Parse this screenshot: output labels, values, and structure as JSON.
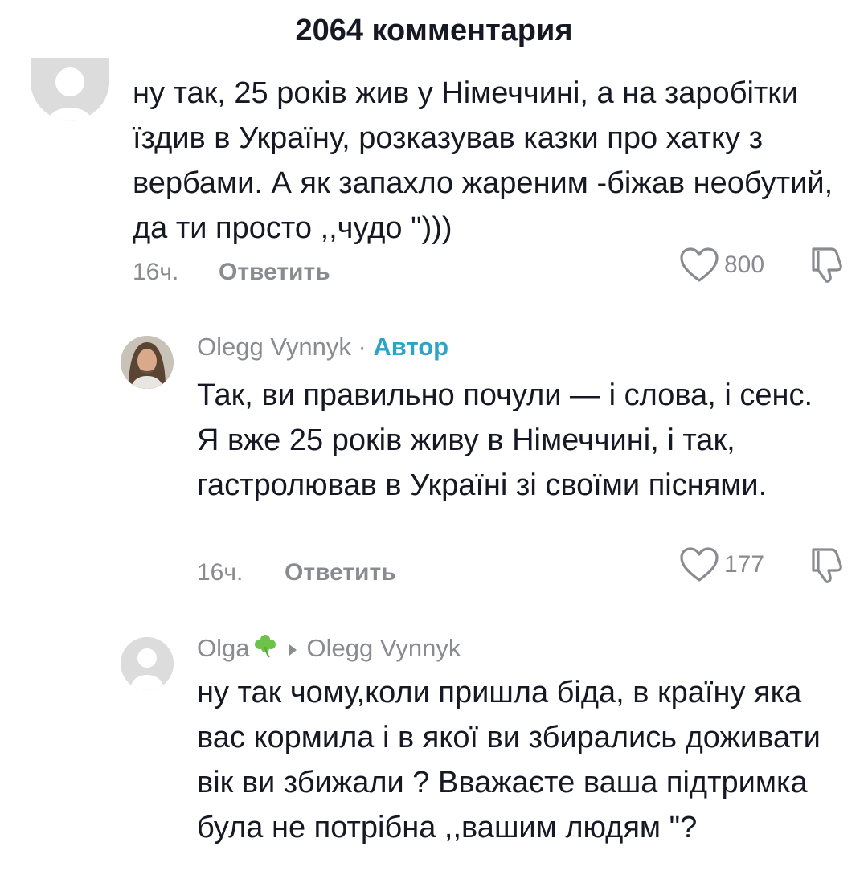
{
  "header": {
    "title": "2064 комментария"
  },
  "comments": [
    {
      "text": "ну так, 25 років жив у Німеччині, а на заробітки їздив в Україну, розказував казки про хатку з вербами. А як запахло жареним -біжав необутий, да ти просто ,,чудо \")))",
      "time": "16ч.",
      "reply_label": "Ответить",
      "likes": "800"
    },
    {
      "author": "Olegg Vynnyk",
      "separator": " · ",
      "author_badge": "Автор",
      "text": "Так, ви правильно почули — і слова, і сенс. Я вже 25 років живу в Німеччині, і так, гастролював в Україні зі своїми піснями.",
      "time": "16ч.",
      "reply_label": "Ответить",
      "likes": "177"
    },
    {
      "author": "Olga",
      "reply_to": "Olegg Vynnyk",
      "text": "ну так чому,коли пришла біда, в країну яка вас кормила і в якої ви збирались доживати вік ви збижали ? Вважаєте ваша підтримка була не потрібна ,,вашим людям \"?"
    }
  ],
  "colors": {
    "text": "#161823",
    "muted": "#8a8b91",
    "author_badge": "#2ba4c8",
    "clover": "#6cc24a"
  },
  "icons": [
    "default-avatar-icon",
    "heart-icon",
    "dislike-icon",
    "clover-icon",
    "caret-right-icon"
  ]
}
